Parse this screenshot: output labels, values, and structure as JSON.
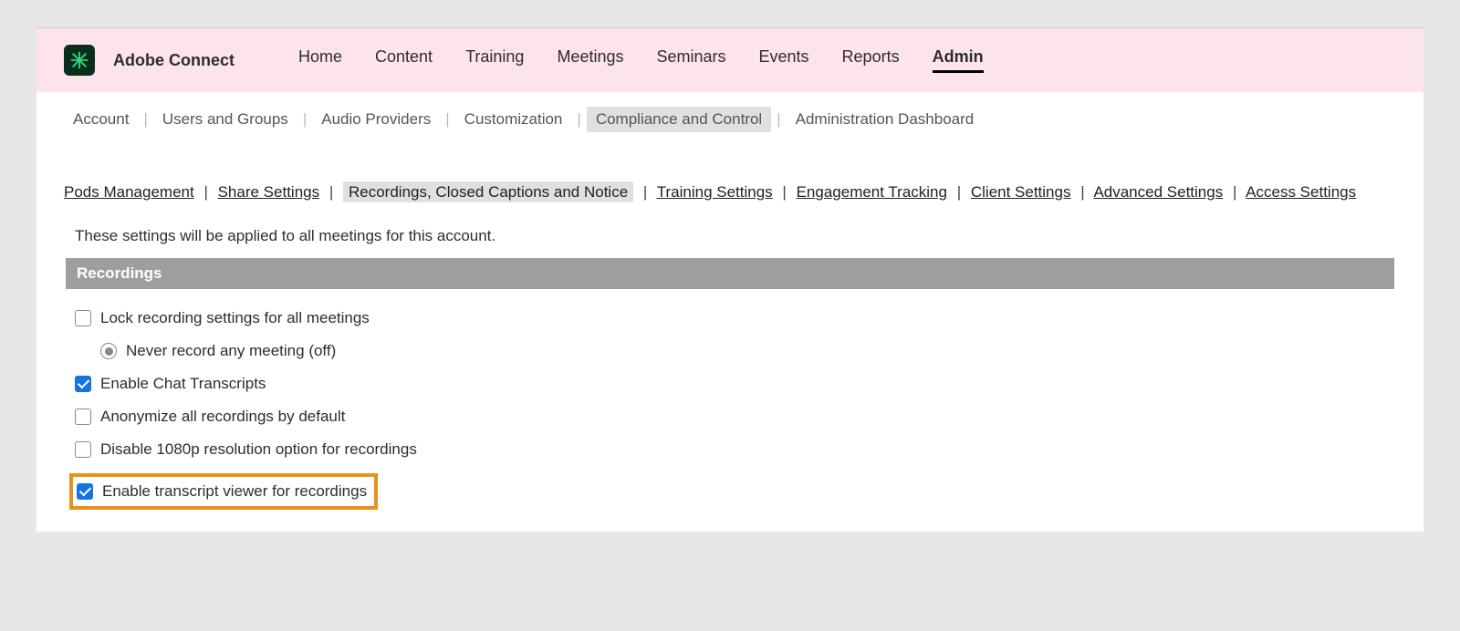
{
  "app_title": "Adobe Connect",
  "nav": {
    "items": [
      {
        "label": "Home"
      },
      {
        "label": "Content"
      },
      {
        "label": "Training"
      },
      {
        "label": "Meetings"
      },
      {
        "label": "Seminars"
      },
      {
        "label": "Events"
      },
      {
        "label": "Reports"
      },
      {
        "label": "Admin",
        "active": true
      }
    ]
  },
  "subnav": {
    "items": [
      {
        "label": "Account"
      },
      {
        "label": "Users and Groups"
      },
      {
        "label": "Audio Providers"
      },
      {
        "label": "Customization"
      },
      {
        "label": "Compliance and Control",
        "active": true
      },
      {
        "label": "Administration Dashboard"
      }
    ]
  },
  "tabs": {
    "items": [
      {
        "label": "Pods Management"
      },
      {
        "label": "Share Settings"
      },
      {
        "label": "Recordings, Closed Captions and Notice",
        "active": true
      },
      {
        "label": "Training Settings"
      },
      {
        "label": "Engagement Tracking"
      },
      {
        "label": "Client Settings"
      },
      {
        "label": "Advanced Settings"
      },
      {
        "label": "Access Settings"
      }
    ]
  },
  "description": "These settings will be applied to all meetings for this account.",
  "section_header": "Recordings",
  "settings": {
    "lock_recording": {
      "label": "Lock recording settings for all meetings",
      "checked": false
    },
    "never_record": {
      "label": "Never record any meeting (off)",
      "selected": true
    },
    "enable_chat_transcripts": {
      "label": "Enable Chat Transcripts",
      "checked": true
    },
    "anonymize_all": {
      "label": "Anonymize all recordings by default",
      "checked": false
    },
    "disable_1080p": {
      "label": "Disable 1080p resolution option for recordings",
      "checked": false
    },
    "enable_transcript_viewer": {
      "label": "Enable transcript viewer for recordings",
      "checked": true
    }
  }
}
